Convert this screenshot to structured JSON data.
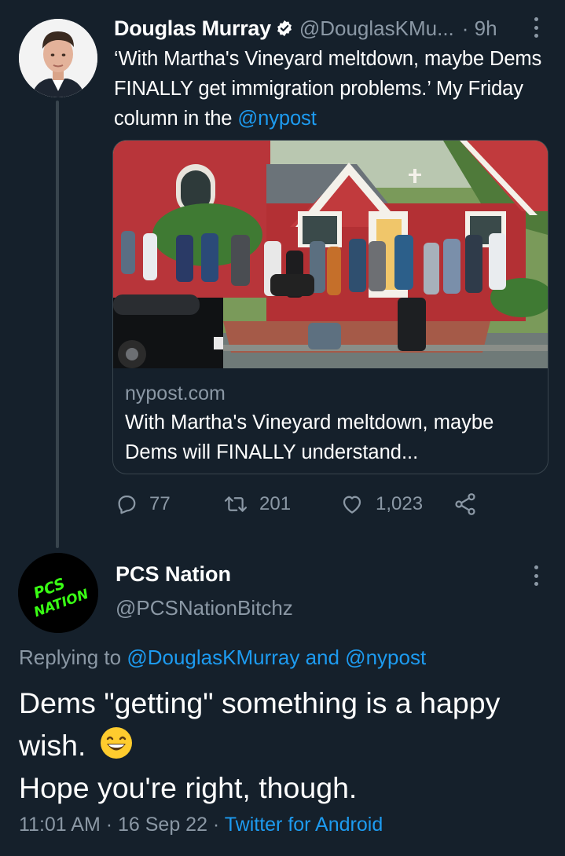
{
  "tweet1": {
    "author_name": "Douglas Murray",
    "handle": "@DouglasKMu...",
    "time": "· 9h",
    "text_before_mention": "‘With Martha's Vineyard meltdown, maybe Dems FINALLY get immigration problems.’ My Friday column in the ",
    "mention": "@nypost",
    "card": {
      "domain": "nypost.com",
      "title": "With Martha's Vineyard meltdown, maybe Dems will FINALLY understand..."
    },
    "actions": {
      "replies": "77",
      "retweets": "201",
      "likes": "1,023"
    }
  },
  "tweet2": {
    "author_name": "PCS Nation",
    "handle": "@PCSNationBitchz",
    "avatar_text_line1": "PCS",
    "avatar_text_line2": "NATION",
    "replying_prefix": "Replying to ",
    "replying_user1": "@DouglasKMurray",
    "replying_and": " and ",
    "replying_user2": "@nypost",
    "text_line1": "Dems \"getting\" something is a happy wish.",
    "text_line2": "Hope you're right, though.",
    "time": "11:01 AM · 16 Sep 22 · ",
    "source": "Twitter for Android"
  },
  "colors": {
    "background": "#15202b",
    "accent": "#1d9bf0",
    "secondary_text": "#8b98a5",
    "border": "#38444d",
    "avatar_neon": "#39ff14"
  }
}
